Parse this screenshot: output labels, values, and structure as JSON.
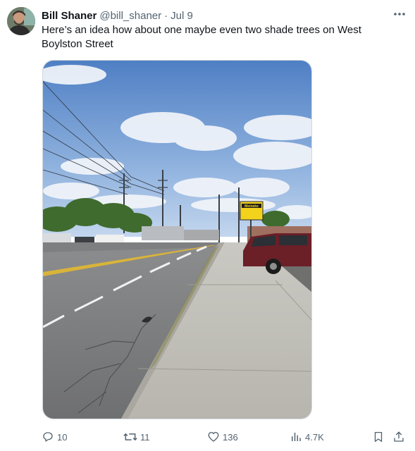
{
  "tweet": {
    "author_name": "Bill Shaner",
    "author_handle": "@bill_shaner",
    "separator": "·",
    "date": "Jul 9",
    "text": "Here’s an idea how about one maybe even two shade trees on West Boylston Street",
    "more_icon": "more-horizontal-icon"
  },
  "media": {
    "sign_text": "Meineke"
  },
  "actions": {
    "replies": "10",
    "retweets": "11",
    "likes": "136",
    "views": "4.7K",
    "icons": [
      "reply-icon",
      "retweet-icon",
      "like-icon",
      "views-icon",
      "bookmark-icon",
      "share-icon"
    ]
  },
  "colors": {
    "text_primary": "#0f1419",
    "text_secondary": "#536471",
    "border": "#cfd9de"
  }
}
